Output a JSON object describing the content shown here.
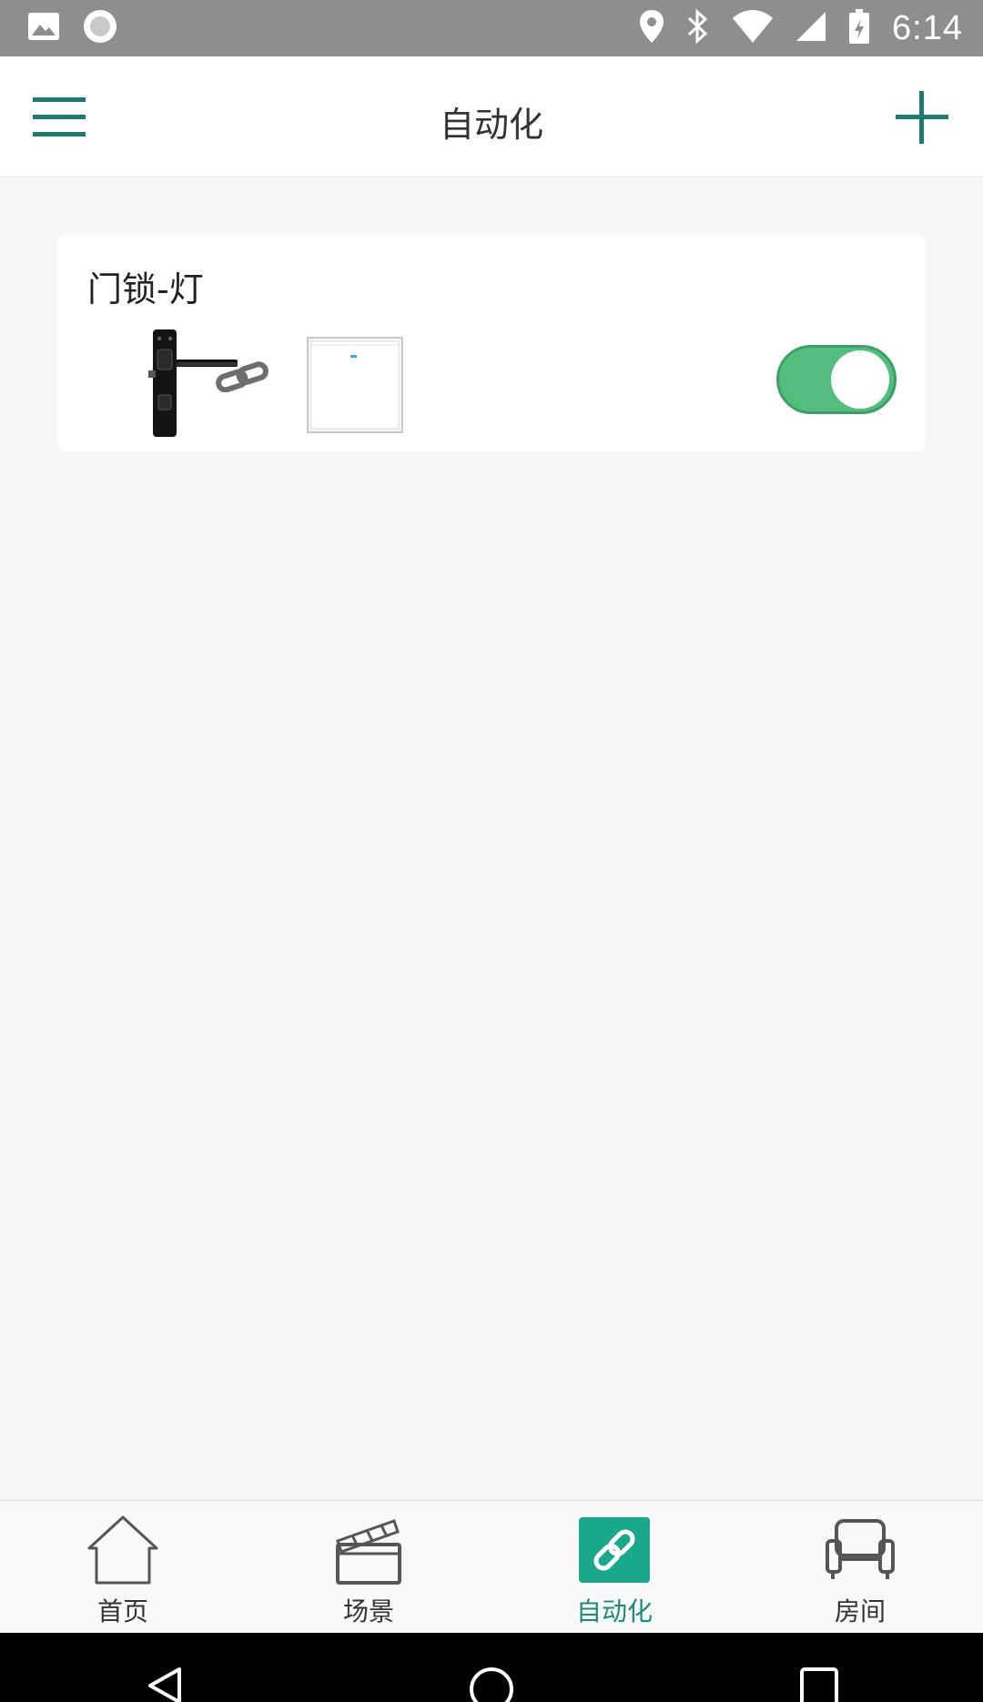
{
  "status_bar": {
    "time": "6:14",
    "icons_left": [
      "image-icon",
      "record-icon"
    ],
    "icons_right": [
      "location-icon",
      "bluetooth-icon",
      "wifi-icon",
      "signal-icon",
      "battery-icon"
    ]
  },
  "header": {
    "title": "自动化",
    "menu_icon": "hamburger-menu-icon",
    "add_icon": "plus-icon",
    "accent": "#1f7a72"
  },
  "automations": [
    {
      "name": "门锁-灯",
      "trigger_device": "door-lock-icon",
      "link_icon": "chain-link-icon",
      "action_device": "wall-switch-icon",
      "enabled": true,
      "toggle_color": "#52bd7d"
    }
  ],
  "bottom_nav": {
    "items": [
      {
        "label": "首页",
        "icon": "home-icon",
        "active": false
      },
      {
        "label": "场景",
        "icon": "clapperboard-icon",
        "active": false
      },
      {
        "label": "自动化",
        "icon": "link-icon",
        "active": true
      },
      {
        "label": "房间",
        "icon": "sofa-icon",
        "active": false
      }
    ],
    "active_color": "#1aa88a"
  },
  "system_bar": {
    "buttons": [
      "back-icon",
      "home-circle-icon",
      "recents-icon"
    ]
  }
}
